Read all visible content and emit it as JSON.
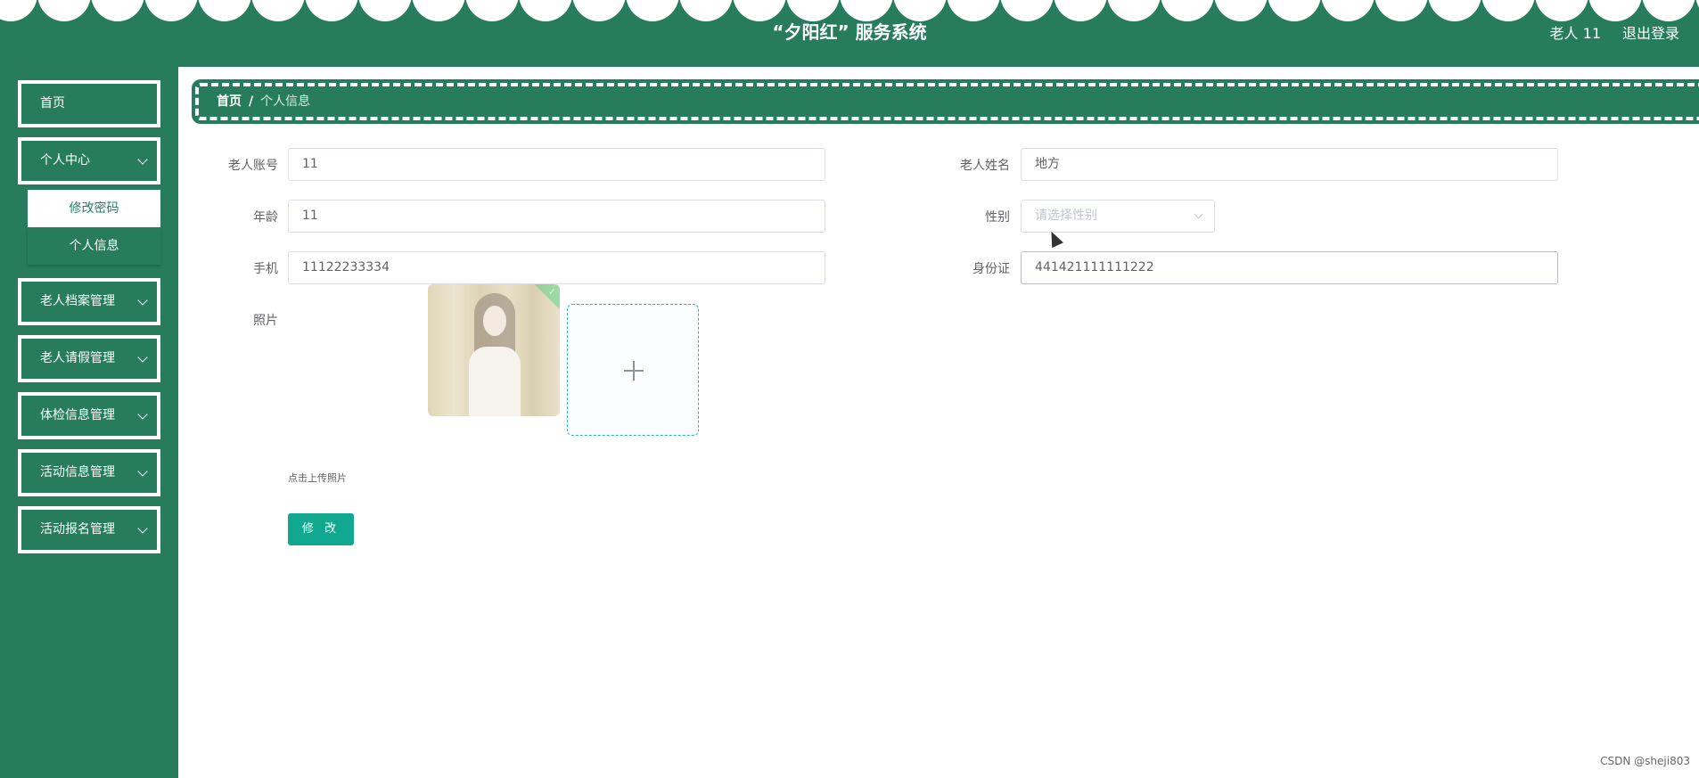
{
  "header": {
    "title": "“夕阳红” 服务系统",
    "user": "老人 11",
    "logout": "退出登录"
  },
  "sidebar": {
    "home": "首页",
    "personal_center": "个人中心",
    "sub_items": [
      "修改密码",
      "个人信息"
    ],
    "items": [
      "老人档案管理",
      "老人请假管理",
      "体检信息管理",
      "活动信息管理",
      "活动报名管理"
    ]
  },
  "breadcrumb": {
    "home": "首页",
    "separator": "/",
    "current": "个人信息"
  },
  "form": {
    "account_label": "老人账号",
    "account_value": "11",
    "name_label": "老人姓名",
    "name_value": "地方",
    "age_label": "年龄",
    "age_value": "11",
    "gender_label": "性别",
    "gender_placeholder": "请选择性别",
    "phone_label": "手机",
    "phone_value": "11122233334",
    "id_label": "身份证",
    "id_value": "441421111111222",
    "photo_label": "照片",
    "upload_tip": "点击上传照片",
    "submit": "修 改"
  },
  "watermark": "CSDN @sheji803",
  "colors": {
    "primary": "#277c5e",
    "button": "#10a98f",
    "upload_border": "#2ab5b9"
  }
}
